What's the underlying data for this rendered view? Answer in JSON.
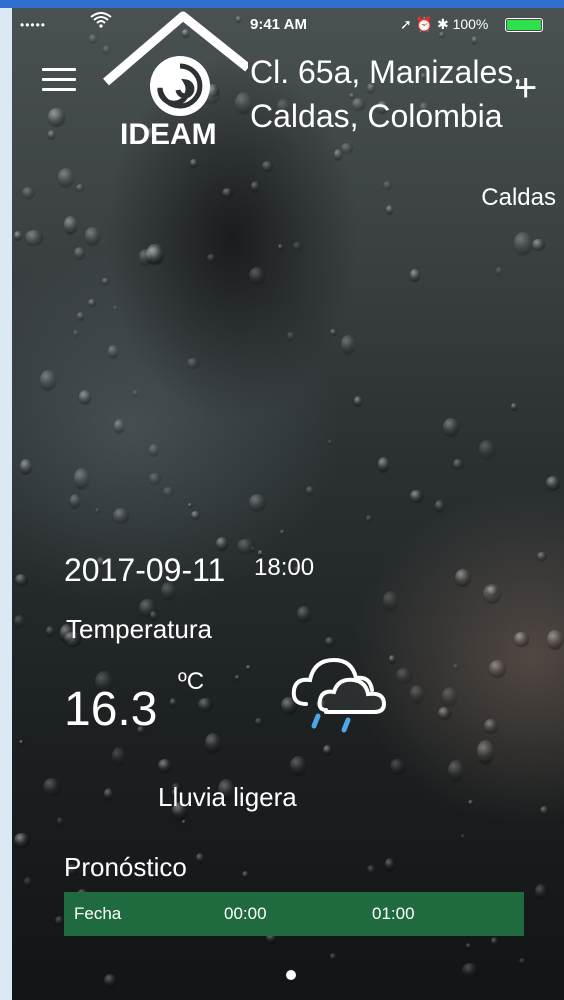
{
  "status_bar": {
    "signal": "•••••",
    "time": "9:41 AM",
    "right_text": "100%",
    "battery_color": "#2ee04a"
  },
  "header": {
    "menu_icon": "hamburger-icon",
    "logo_text": "IDEAM",
    "location": "Cl. 65a, Manizales, Caldas, Colombia",
    "add_icon": "plus-icon",
    "region": "Caldas"
  },
  "weather": {
    "date": "2017-09-11",
    "time": "18:00",
    "temperature_label": "Temperatura",
    "temperature_value": "16.3",
    "temperature_unit": "ºC",
    "condition": "Lluvia ligera",
    "icon": "rain-cloud-icon"
  },
  "forecast": {
    "label": "Pronóstico",
    "columns": [
      "Fecha",
      "00:00",
      "01:00"
    ],
    "bar_color": "#1f6b3f"
  },
  "pager": {
    "active_index": 0
  }
}
